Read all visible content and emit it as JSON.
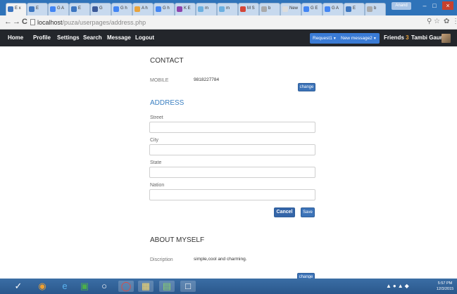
{
  "browser": {
    "tabs": [
      {
        "label": "E x",
        "active": true
      },
      {
        "label": "E",
        "active": false
      },
      {
        "label": "G A",
        "active": false
      },
      {
        "label": "E",
        "active": false
      },
      {
        "label": "G",
        "active": false
      },
      {
        "label": "G h",
        "active": false
      },
      {
        "label": "A h",
        "active": false
      },
      {
        "label": "G h",
        "active": false
      },
      {
        "label": "K E",
        "active": false
      },
      {
        "label": "m",
        "active": false
      },
      {
        "label": "m",
        "active": false
      },
      {
        "label": "M S",
        "active": false
      },
      {
        "label": "b",
        "active": false
      },
      {
        "label": "New",
        "active": false
      },
      {
        "label": "G E",
        "active": false
      },
      {
        "label": "G A",
        "active": false
      },
      {
        "label": "E",
        "active": false
      },
      {
        "label": "b",
        "active": false
      }
    ],
    "window_user": "Anand",
    "url_host": "localhost",
    "url_path": "/puza/userpages/address.php"
  },
  "navbar": {
    "links": [
      "Home",
      "Profile",
      "Settings",
      "Search",
      "Message",
      "Logout"
    ],
    "request_label": "Request1",
    "new_message_label": "New message2",
    "friends_label": "Friends",
    "friends_count": "3",
    "user_name": "Tambi Gaurav"
  },
  "contact": {
    "title": "CONTACT",
    "mobile_label": "MOBILE",
    "mobile_value": "9818227784",
    "change_label": "change"
  },
  "address": {
    "title": "ADDRESS",
    "street_label": "Street",
    "city_label": "City",
    "state_label": "State",
    "nation_label": "Nation",
    "street_value": "",
    "city_value": "",
    "state_value": "",
    "nation_value": "",
    "cancel_label": "Cancel",
    "save_label": "Save"
  },
  "about": {
    "title": "ABOUT MYSELF",
    "description_label": "Discription",
    "description_value": "simple,cool and charming.",
    "change_label": "change"
  },
  "taskbar": {
    "clock_time": "5:57 PM",
    "clock_date": "12/3/2015"
  },
  "colors": {
    "navbar_bg": "#23262b",
    "accent_blue": "#3a7bd5",
    "button_blue": "#3c73b8",
    "friends_count": "#e6a23c",
    "section_blue": "#3a7fc1"
  }
}
